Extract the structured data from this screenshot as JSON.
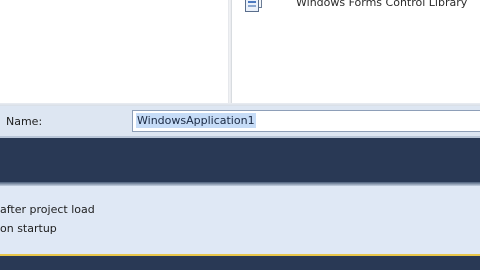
{
  "templates": {
    "items": [
      {
        "label": "Windows Forms Control Library",
        "icon": "project-template-icon"
      }
    ]
  },
  "name_field": {
    "label": "Name:",
    "value": "WindowsApplication1"
  },
  "options": {
    "line1": "after project load",
    "line2": "on startup"
  },
  "colors": {
    "dark_band": "#293955",
    "panel_bg": "#dfe8f4",
    "selection": "#c6dcf7",
    "accent_line": "#e8c64a"
  }
}
